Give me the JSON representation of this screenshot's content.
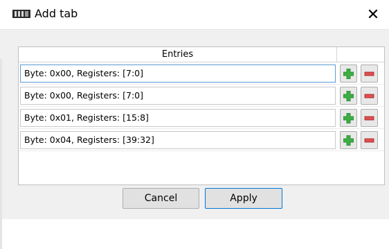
{
  "window": {
    "title": "Add tab",
    "close_glyph": "✕"
  },
  "table": {
    "header": "Entries",
    "rows": [
      {
        "value": "Byte: 0x00, Registers: [7:0]",
        "focused": true
      },
      {
        "value": "Byte: 0x00, Registers: [7:0]",
        "focused": false
      },
      {
        "value": "Byte: 0x01, Registers: [15:8]",
        "focused": false
      },
      {
        "value": "Byte: 0x04, Registers: [39:32]",
        "focused": false
      }
    ],
    "add_icon": "green-plus-icon",
    "remove_icon": "red-minus-icon"
  },
  "buttons": {
    "cancel": "Cancel",
    "apply": "Apply"
  },
  "colors": {
    "add_green": "#3cb043",
    "remove_red": "#e05050",
    "focus_blue": "#5b9bd5",
    "default_button_border": "#0078d7"
  }
}
